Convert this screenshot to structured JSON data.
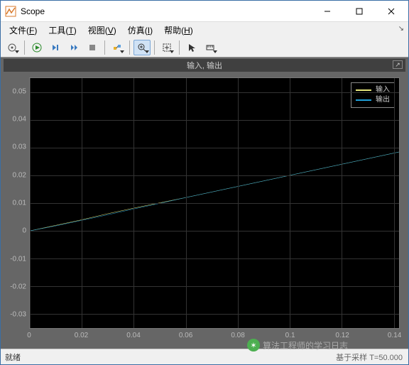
{
  "window": {
    "title": "Scope"
  },
  "menu": {
    "file": "文件",
    "file_u": "F",
    "tools": "工具",
    "tools_u": "T",
    "view": "视图",
    "view_u": "V",
    "sim": "仿真",
    "sim_u": "I",
    "help": "帮助",
    "help_u": "H"
  },
  "plot": {
    "title": "输入, 输出"
  },
  "legend": {
    "s1": {
      "label": "输入",
      "color": "#e6e67a"
    },
    "s2": {
      "label": "输出",
      "color": "#1f9fd8"
    }
  },
  "status": {
    "left": "就绪",
    "right": "基于采样 T=50.000"
  },
  "watermark": "算法工程师的学习日志",
  "chart_data": {
    "type": "line",
    "title": "输入, 输出",
    "xlabel": "",
    "ylabel": "",
    "xlim": [
      0,
      0.142
    ],
    "ylim": [
      -0.035,
      0.055
    ],
    "xticks": [
      0,
      0.02,
      0.04,
      0.06,
      0.08,
      0.1,
      0.12,
      0.14
    ],
    "yticks": [
      -0.03,
      -0.02,
      -0.01,
      0,
      0.01,
      0.02,
      0.03,
      0.04,
      0.05
    ],
    "x": [
      0,
      0.01,
      0.02,
      0.03,
      0.04,
      0.05,
      0.06,
      0.07,
      0.08,
      0.09,
      0.1,
      0.11,
      0.12,
      0.13,
      0.14,
      0.142
    ],
    "series": [
      {
        "name": "输入",
        "color": "#e6e67a",
        "values": [
          0,
          0.002,
          0.004,
          0.0062,
          0.0082,
          0.0101,
          0.012,
          0.014,
          0.016,
          0.018,
          0.02,
          0.022,
          0.024,
          0.026,
          0.028,
          0.0284
        ]
      },
      {
        "name": "输出",
        "color": "#1f9fd8",
        "values": [
          0,
          0.0018,
          0.0038,
          0.0058,
          0.0079,
          0.0099,
          0.012,
          0.014,
          0.016,
          0.018,
          0.02,
          0.022,
          0.024,
          0.026,
          0.028,
          0.0284
        ]
      }
    ],
    "legend_position": "upper right",
    "grid": true
  }
}
